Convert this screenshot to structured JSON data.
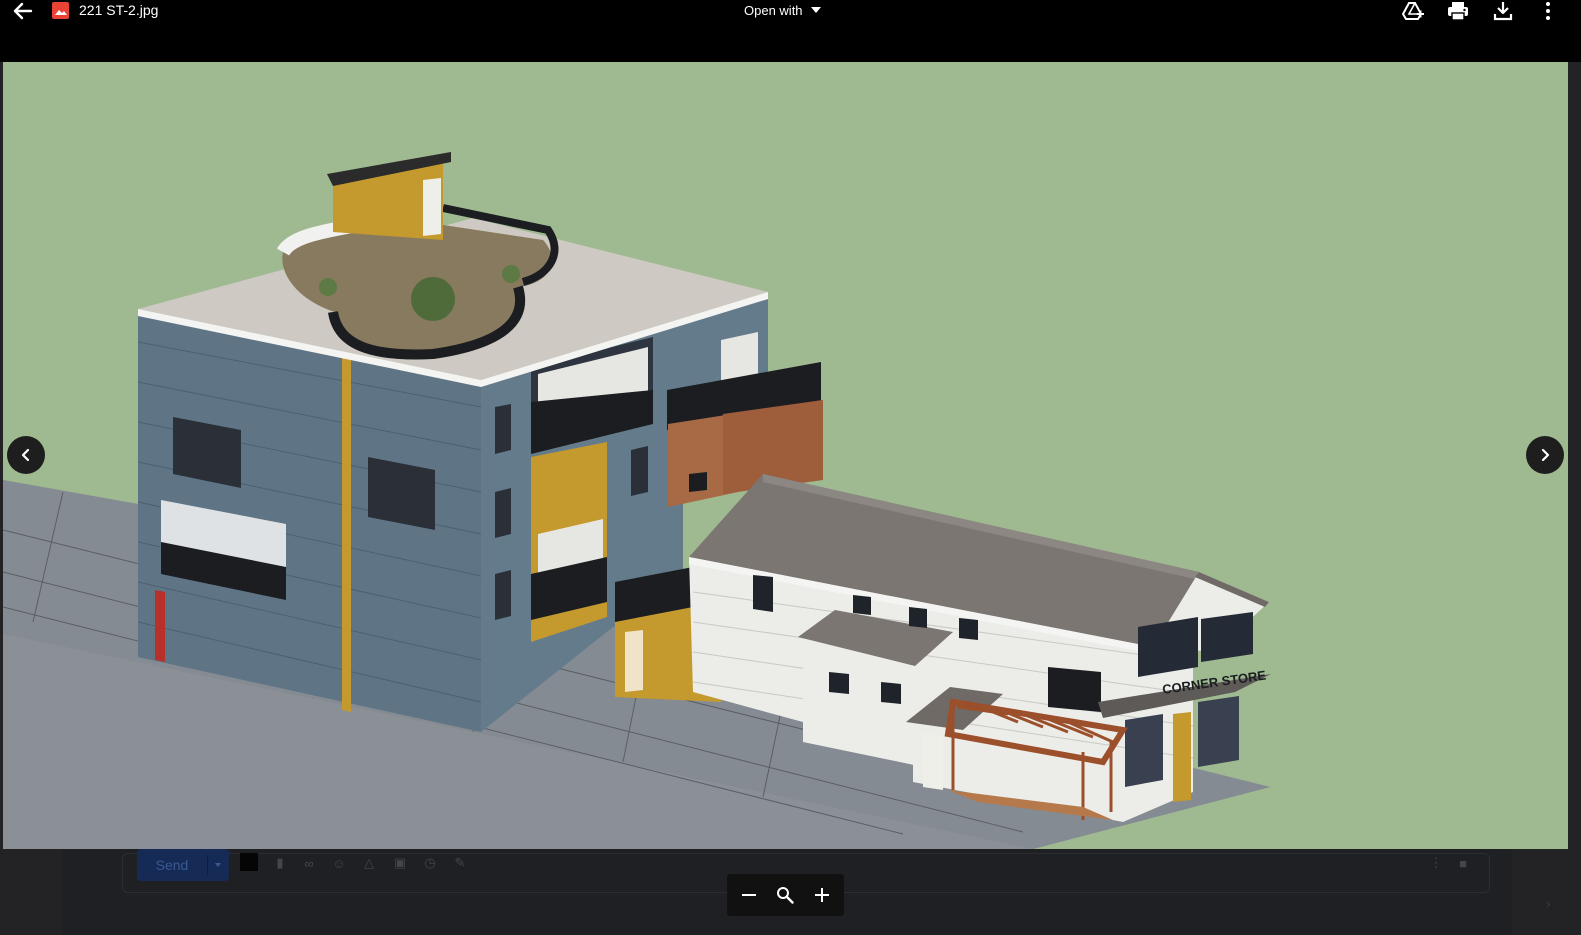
{
  "topbar": {
    "file_name": "221 ST-2.jpg",
    "open_with_label": "Open with",
    "icons": [
      "back-arrow-icon",
      "image-file-icon",
      "add-to-drive-icon",
      "print-icon",
      "download-icon",
      "more-vert-icon"
    ]
  },
  "image": {
    "sign_text": "CORNER STORE",
    "colors": {
      "sky": "#9fb990",
      "siding_blue": "#5f7586",
      "accent_yellow": "#c49a2e",
      "brick": "#a86a45",
      "roof": "#7b7672",
      "white_siding": "#ecece9"
    }
  },
  "compose": {
    "send_label": "Send"
  },
  "zoom": {
    "zoom_out": "zoom-out",
    "fit": "zoom-fit",
    "zoom_in": "zoom-in"
  }
}
